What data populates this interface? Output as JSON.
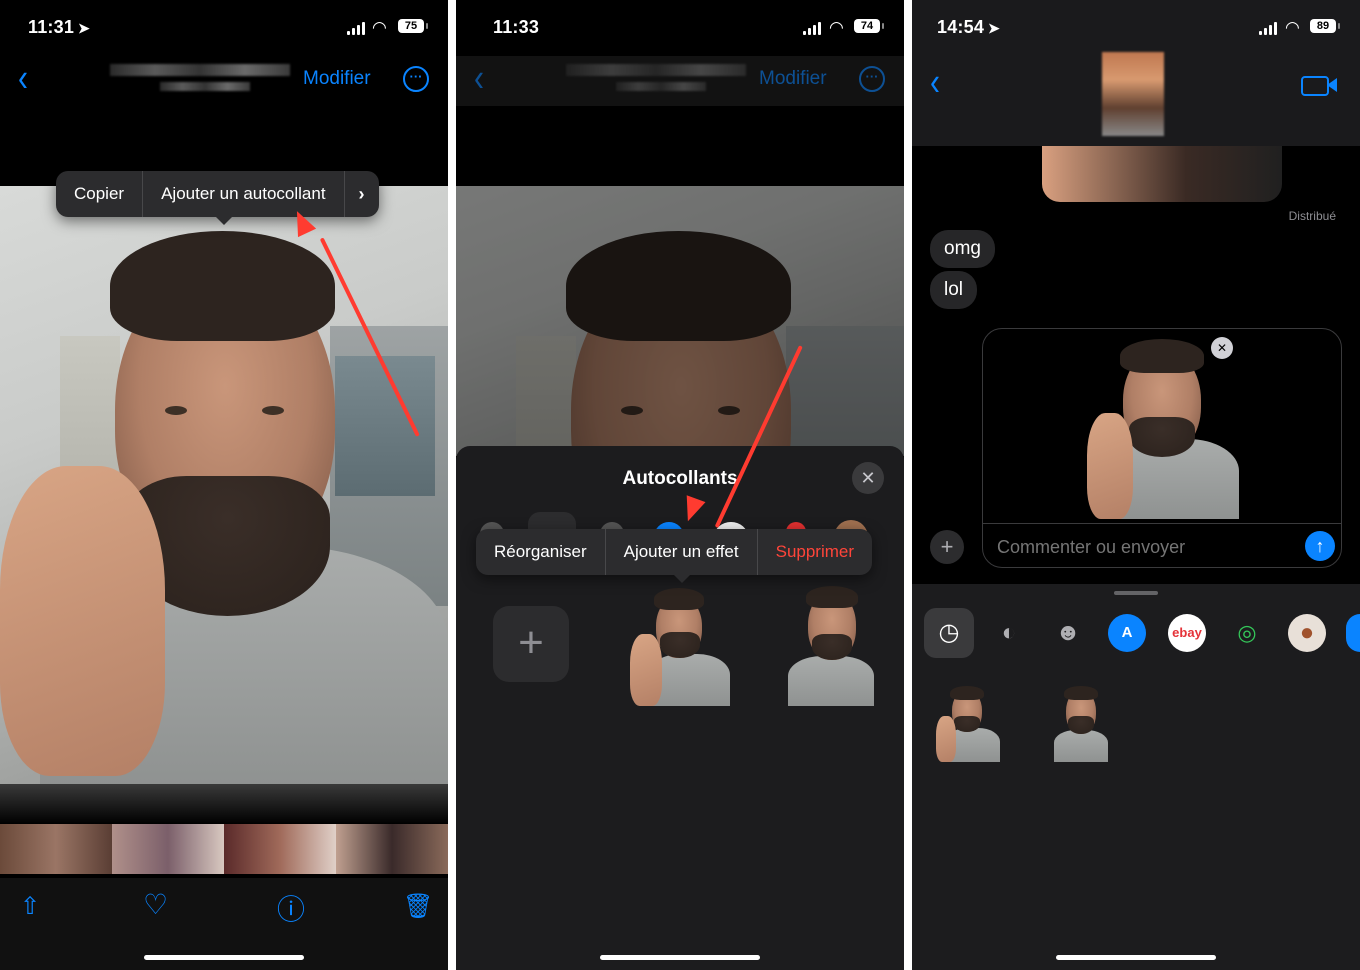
{
  "panel1": {
    "status": {
      "time": "11:31",
      "loc_icon": "➤",
      "battery": "75"
    },
    "nav": {
      "back_icon": "‹",
      "edit_label": "Modifier",
      "more_icon": "···"
    },
    "context_menu": {
      "items": [
        "Copier",
        "Ajouter un autocollant"
      ],
      "more_icon": "›"
    },
    "toolbar": {
      "share_icon": "⇧",
      "heart_icon": "♡",
      "info_icon": "ⓘ",
      "trash_icon": "🗑"
    }
  },
  "panel2": {
    "status": {
      "time": "11:33",
      "battery": "74"
    },
    "nav": {
      "back_icon": "‹",
      "edit_label": "Modifier",
      "more_icon": "···"
    },
    "sheet": {
      "title": "Autocollants",
      "close_icon": "✕",
      "add_icon": "+"
    },
    "context_menu": {
      "items": [
        "Réorganiser",
        "Ajouter un effet",
        "Supprimer"
      ]
    },
    "colors": {
      "destructive": "#ff453a"
    }
  },
  "panel3": {
    "status": {
      "time": "14:54",
      "loc_icon": "➤",
      "battery": "89"
    },
    "nav": {
      "back_icon": "‹",
      "video_icon": "▭"
    },
    "delivered_label": "Distribué",
    "messages": [
      "omg",
      "lol"
    ],
    "composer": {
      "placeholder": "Commenter ou envoyer",
      "remove_icon": "✕",
      "send_icon": "↑",
      "add_icon": "+"
    },
    "apps": [
      {
        "icon": "recents-icon",
        "glyph": "◷"
      },
      {
        "icon": "stickers-icon",
        "glyph": "◐"
      },
      {
        "icon": "emoji-icon",
        "glyph": "☻"
      },
      {
        "icon": "appstore-icon",
        "glyph": "A"
      },
      {
        "icon": "ebay-icon",
        "glyph": "ebay"
      },
      {
        "icon": "activity-icon",
        "glyph": "◎"
      },
      {
        "icon": "memoji-icon",
        "glyph": "●"
      }
    ]
  }
}
